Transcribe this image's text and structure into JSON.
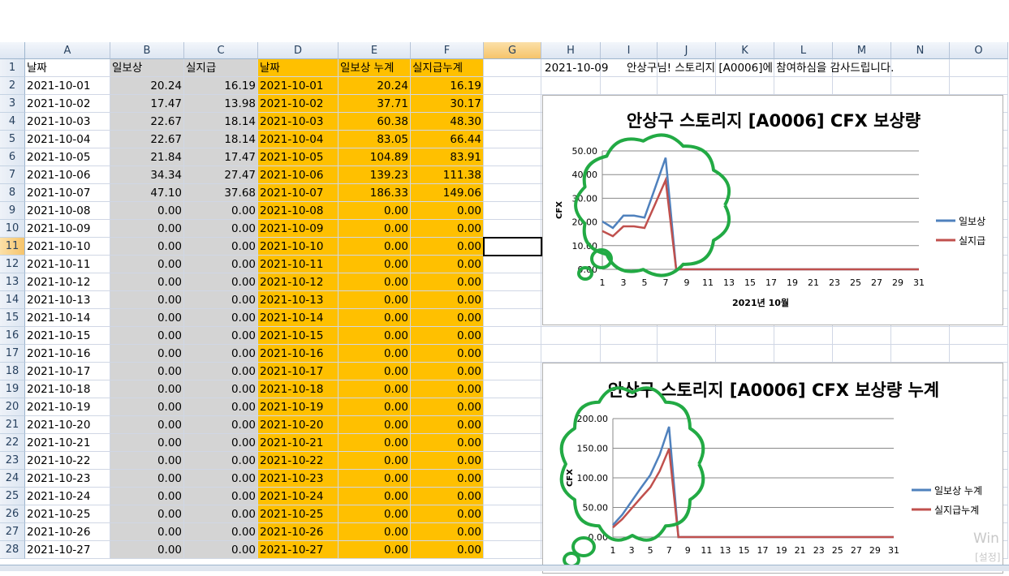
{
  "columns": [
    "A",
    "B",
    "C",
    "D",
    "E",
    "F",
    "G",
    "H",
    "I",
    "J",
    "K",
    "L",
    "M",
    "N",
    "O"
  ],
  "selected_column": "G",
  "selected_row": "11",
  "header_row": [
    "날짜",
    "일보상",
    "실지급",
    "날짜",
    "일보상 누계",
    "실지급누계"
  ],
  "rows": [
    [
      "2",
      "2021-10-01",
      "20.24",
      "16.19",
      "2021-10-01",
      "20.24",
      "16.19"
    ],
    [
      "3",
      "2021-10-02",
      "17.47",
      "13.98",
      "2021-10-02",
      "37.71",
      "30.17"
    ],
    [
      "4",
      "2021-10-03",
      "22.67",
      "18.14",
      "2021-10-03",
      "60.38",
      "48.30"
    ],
    [
      "5",
      "2021-10-04",
      "22.67",
      "18.14",
      "2021-10-04",
      "83.05",
      "66.44"
    ],
    [
      "6",
      "2021-10-05",
      "21.84",
      "17.47",
      "2021-10-05",
      "104.89",
      "83.91"
    ],
    [
      "7",
      "2021-10-06",
      "34.34",
      "27.47",
      "2021-10-06",
      "139.23",
      "111.38"
    ],
    [
      "8",
      "2021-10-07",
      "47.10",
      "37.68",
      "2021-10-07",
      "186.33",
      "149.06"
    ],
    [
      "9",
      "2021-10-08",
      "0.00",
      "0.00",
      "2021-10-08",
      "0.00",
      "0.00"
    ],
    [
      "10",
      "2021-10-09",
      "0.00",
      "0.00",
      "2021-10-09",
      "0.00",
      "0.00"
    ],
    [
      "11",
      "2021-10-10",
      "0.00",
      "0.00",
      "2021-10-10",
      "0.00",
      "0.00"
    ],
    [
      "12",
      "2021-10-11",
      "0.00",
      "0.00",
      "2021-10-11",
      "0.00",
      "0.00"
    ],
    [
      "13",
      "2021-10-12",
      "0.00",
      "0.00",
      "2021-10-12",
      "0.00",
      "0.00"
    ],
    [
      "14",
      "2021-10-13",
      "0.00",
      "0.00",
      "2021-10-13",
      "0.00",
      "0.00"
    ],
    [
      "15",
      "2021-10-14",
      "0.00",
      "0.00",
      "2021-10-14",
      "0.00",
      "0.00"
    ],
    [
      "16",
      "2021-10-15",
      "0.00",
      "0.00",
      "2021-10-15",
      "0.00",
      "0.00"
    ],
    [
      "17",
      "2021-10-16",
      "0.00",
      "0.00",
      "2021-10-16",
      "0.00",
      "0.00"
    ],
    [
      "18",
      "2021-10-17",
      "0.00",
      "0.00",
      "2021-10-17",
      "0.00",
      "0.00"
    ],
    [
      "19",
      "2021-10-18",
      "0.00",
      "0.00",
      "2021-10-18",
      "0.00",
      "0.00"
    ],
    [
      "20",
      "2021-10-19",
      "0.00",
      "0.00",
      "2021-10-19",
      "0.00",
      "0.00"
    ],
    [
      "21",
      "2021-10-20",
      "0.00",
      "0.00",
      "2021-10-20",
      "0.00",
      "0.00"
    ],
    [
      "22",
      "2021-10-21",
      "0.00",
      "0.00",
      "2021-10-21",
      "0.00",
      "0.00"
    ],
    [
      "23",
      "2021-10-22",
      "0.00",
      "0.00",
      "2021-10-22",
      "0.00",
      "0.00"
    ],
    [
      "24",
      "2021-10-23",
      "0.00",
      "0.00",
      "2021-10-23",
      "0.00",
      "0.00"
    ],
    [
      "25",
      "2021-10-24",
      "0.00",
      "0.00",
      "2021-10-24",
      "0.00",
      "0.00"
    ],
    [
      "26",
      "2021-10-25",
      "0.00",
      "0.00",
      "2021-10-25",
      "0.00",
      "0.00"
    ],
    [
      "27",
      "2021-10-26",
      "0.00",
      "0.00",
      "2021-10-26",
      "0.00",
      "0.00"
    ],
    [
      "28",
      "2021-10-27",
      "0.00",
      "0.00",
      "2021-10-27",
      "0.00",
      "0.00"
    ]
  ],
  "message": {
    "date": "2021-10-09",
    "text": "안상구님!  스토리지 [A0006]에 참여하심을 감사드립니다."
  },
  "watermark": {
    "line1": "Win",
    "line2": "[설정]"
  },
  "colors": {
    "gray_fill": "#d4d4d4",
    "orange_fill": "#ffc000",
    "series1": "#4f81bd",
    "series2": "#c0504d",
    "doodle": "#22aa44"
  },
  "chart_data": [
    {
      "type": "line",
      "title": "안상구 스토리지 [A0006] CFX 보상량",
      "xlabel": "2021년 10월",
      "ylabel": "CFX",
      "ylim": [
        0,
        50
      ],
      "yticks": [
        "0.00",
        "10.00",
        "20.00",
        "30.00",
        "40.00",
        "50.00"
      ],
      "xticks": [
        "1",
        "3",
        "5",
        "7",
        "9",
        "11",
        "13",
        "15",
        "17",
        "19",
        "21",
        "23",
        "25",
        "27",
        "29",
        "31"
      ],
      "x": [
        1,
        2,
        3,
        4,
        5,
        6,
        7,
        8,
        9,
        10,
        11,
        12,
        13,
        14,
        15,
        16,
        17,
        18,
        19,
        20,
        21,
        22,
        23,
        24,
        25,
        26,
        27,
        28,
        29,
        30,
        31
      ],
      "series": [
        {
          "name": "일보상",
          "values": [
            20.24,
            17.47,
            22.67,
            22.67,
            21.84,
            34.34,
            47.1,
            0,
            0,
            0,
            0,
            0,
            0,
            0,
            0,
            0,
            0,
            0,
            0,
            0,
            0,
            0,
            0,
            0,
            0,
            0,
            0,
            0,
            0,
            0,
            0
          ]
        },
        {
          "name": "실지급",
          "values": [
            16.19,
            13.98,
            18.14,
            18.14,
            17.47,
            27.47,
            37.68,
            0,
            0,
            0,
            0,
            0,
            0,
            0,
            0,
            0,
            0,
            0,
            0,
            0,
            0,
            0,
            0,
            0,
            0,
            0,
            0,
            0,
            0,
            0,
            0
          ]
        }
      ],
      "grid": true,
      "legend": "right"
    },
    {
      "type": "line",
      "title": "안상구 스토리지 [A0006] CFX 보상량 누계",
      "xlabel": "",
      "ylabel": "CFX",
      "ylim": [
        0,
        200
      ],
      "yticks": [
        "0.00",
        "50.00",
        "100.00",
        "150.00",
        "200.00"
      ],
      "xticks": [
        "1",
        "3",
        "5",
        "7",
        "9",
        "11",
        "13",
        "15",
        "17",
        "19",
        "21",
        "23",
        "25",
        "27",
        "29",
        "31"
      ],
      "x": [
        1,
        2,
        3,
        4,
        5,
        6,
        7,
        8,
        9,
        10,
        11,
        12,
        13,
        14,
        15,
        16,
        17,
        18,
        19,
        20,
        21,
        22,
        23,
        24,
        25,
        26,
        27,
        28,
        29,
        30,
        31
      ],
      "series": [
        {
          "name": "일보상 누계",
          "values": [
            20.24,
            37.71,
            60.38,
            83.05,
            104.89,
            139.23,
            186.33,
            0,
            0,
            0,
            0,
            0,
            0,
            0,
            0,
            0,
            0,
            0,
            0,
            0,
            0,
            0,
            0,
            0,
            0,
            0,
            0,
            0,
            0,
            0,
            0
          ]
        },
        {
          "name": "실지급누계",
          "values": [
            16.19,
            30.17,
            48.3,
            66.44,
            83.91,
            111.38,
            149.06,
            0,
            0,
            0,
            0,
            0,
            0,
            0,
            0,
            0,
            0,
            0,
            0,
            0,
            0,
            0,
            0,
            0,
            0,
            0,
            0,
            0,
            0,
            0,
            0
          ]
        }
      ],
      "grid": true,
      "legend": "right"
    }
  ]
}
